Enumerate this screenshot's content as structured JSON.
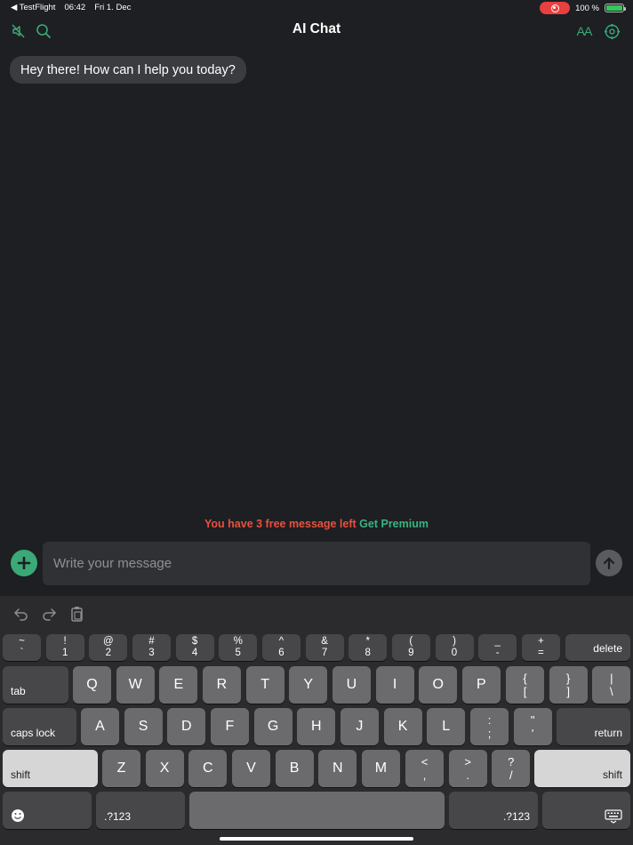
{
  "status_bar": {
    "back_app": "◀ TestFlight",
    "time": "06:42",
    "date": "Fri 1. Dec",
    "battery": "100 %",
    "battery_level": 1.0
  },
  "header": {
    "title": "AI Chat",
    "text_size_label": "AA"
  },
  "messages": [
    {
      "role": "assistant",
      "text": "Hey there! How can I help you today?"
    }
  ],
  "limit": {
    "text": "You have 3 free message left",
    "link": "Get Premium"
  },
  "composer": {
    "placeholder": "Write your message",
    "value": ""
  },
  "colors": {
    "accent": "#3aa977",
    "warning": "#e8513f",
    "background": "#1d1f22"
  },
  "keyboard": {
    "row1": [
      {
        "top": "~",
        "bottom": "`"
      },
      {
        "top": "!",
        "bottom": "1"
      },
      {
        "top": "@",
        "bottom": "2"
      },
      {
        "top": "#",
        "bottom": "3"
      },
      {
        "top": "$",
        "bottom": "4"
      },
      {
        "top": "%",
        "bottom": "5"
      },
      {
        "top": "^",
        "bottom": "6"
      },
      {
        "top": "&",
        "bottom": "7"
      },
      {
        "top": "*",
        "bottom": "8"
      },
      {
        "top": "(",
        "bottom": "9"
      },
      {
        "top": ")",
        "bottom": "0"
      },
      {
        "top": "_",
        "bottom": "-"
      },
      {
        "top": "+",
        "bottom": "="
      }
    ],
    "delete": "delete",
    "tab": "tab",
    "row2": [
      "Q",
      "W",
      "E",
      "R",
      "T",
      "Y",
      "U",
      "I",
      "O",
      "P"
    ],
    "row2_sym": [
      {
        "top": "{",
        "bottom": "["
      },
      {
        "top": "}",
        "bottom": "]"
      },
      {
        "top": "|",
        "bottom": "\\"
      }
    ],
    "caps_lock": "caps lock",
    "row3": [
      "A",
      "S",
      "D",
      "F",
      "G",
      "H",
      "J",
      "K",
      "L"
    ],
    "row3_sym": [
      {
        "top": ":",
        "bottom": ";"
      },
      {
        "top": "\"",
        "bottom": "'"
      }
    ],
    "return": "return",
    "shift": "shift",
    "row4": [
      "Z",
      "X",
      "C",
      "V",
      "B",
      "N",
      "M"
    ],
    "row4_sym": [
      {
        "top": "<",
        "bottom": ","
      },
      {
        "top": ">",
        "bottom": "."
      },
      {
        "top": "?",
        "bottom": "/"
      }
    ],
    "numbers": ".?123"
  }
}
